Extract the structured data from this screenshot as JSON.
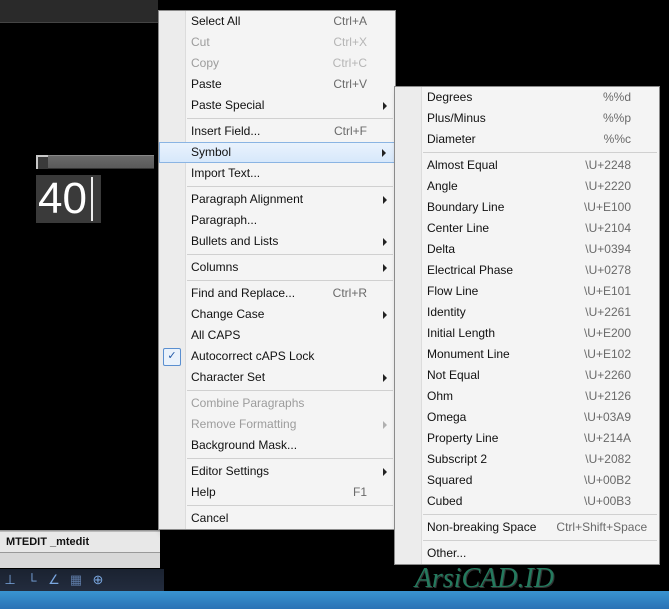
{
  "canvas": {
    "text": "40"
  },
  "commandline": {
    "line1": "MTEDIT _mtedit"
  },
  "watermark": "ArsiCAD.ID",
  "main_menu": {
    "items": [
      {
        "label": "Select All",
        "shortcut": "Ctrl+A"
      },
      {
        "label": "Cut",
        "shortcut": "Ctrl+X",
        "disabled": true
      },
      {
        "label": "Copy",
        "shortcut": "Ctrl+C",
        "disabled": true
      },
      {
        "label": "Paste",
        "shortcut": "Ctrl+V"
      },
      {
        "label": "Paste Special",
        "submenu": true
      },
      {
        "sep": true
      },
      {
        "label": "Insert Field...",
        "shortcut": "Ctrl+F"
      },
      {
        "label": "Symbol",
        "submenu": true,
        "highlight": true
      },
      {
        "label": "Import Text..."
      },
      {
        "sep": true
      },
      {
        "label": "Paragraph Alignment",
        "submenu": true
      },
      {
        "label": "Paragraph..."
      },
      {
        "label": "Bullets and Lists",
        "submenu": true
      },
      {
        "sep": true
      },
      {
        "label": "Columns",
        "submenu": true
      },
      {
        "sep": true
      },
      {
        "label": "Find and Replace...",
        "shortcut": "Ctrl+R"
      },
      {
        "label": "Change Case",
        "submenu": true
      },
      {
        "label": "All CAPS"
      },
      {
        "label": "Autocorrect cAPS Lock",
        "checked": true
      },
      {
        "label": "Character Set",
        "submenu": true
      },
      {
        "sep": true
      },
      {
        "label": "Combine Paragraphs",
        "disabled": true
      },
      {
        "label": "Remove Formatting",
        "submenu": true,
        "disabled": true
      },
      {
        "label": "Background Mask..."
      },
      {
        "sep": true
      },
      {
        "label": "Editor Settings",
        "submenu": true
      },
      {
        "label": "Help",
        "shortcut": "F1"
      },
      {
        "sep": true
      },
      {
        "label": "Cancel"
      }
    ]
  },
  "sub_menu": {
    "items": [
      {
        "label": "Degrees",
        "shortcut": "%%d"
      },
      {
        "label": "Plus/Minus",
        "shortcut": "%%p"
      },
      {
        "label": "Diameter",
        "shortcut": "%%c"
      },
      {
        "sep": true
      },
      {
        "label": "Almost Equal",
        "shortcut": "\\U+2248"
      },
      {
        "label": "Angle",
        "shortcut": "\\U+2220"
      },
      {
        "label": "Boundary Line",
        "shortcut": "\\U+E100"
      },
      {
        "label": "Center Line",
        "shortcut": "\\U+2104"
      },
      {
        "label": "Delta",
        "shortcut": "\\U+0394"
      },
      {
        "label": "Electrical Phase",
        "shortcut": "\\U+0278"
      },
      {
        "label": "Flow Line",
        "shortcut": "\\U+E101"
      },
      {
        "label": "Identity",
        "shortcut": "\\U+2261"
      },
      {
        "label": "Initial Length",
        "shortcut": "\\U+E200"
      },
      {
        "label": "Monument Line",
        "shortcut": "\\U+E102"
      },
      {
        "label": "Not Equal",
        "shortcut": "\\U+2260"
      },
      {
        "label": "Ohm",
        "shortcut": "\\U+2126"
      },
      {
        "label": "Omega",
        "shortcut": "\\U+03A9"
      },
      {
        "label": "Property Line",
        "shortcut": "\\U+214A"
      },
      {
        "label": "Subscript 2",
        "shortcut": "\\U+2082"
      },
      {
        "label": "Squared",
        "shortcut": "\\U+00B2"
      },
      {
        "label": "Cubed",
        "shortcut": "\\U+00B3"
      },
      {
        "sep": true
      },
      {
        "label": "Non-breaking Space",
        "shortcut": "Ctrl+Shift+Space"
      },
      {
        "sep": true
      },
      {
        "label": "Other..."
      }
    ]
  }
}
